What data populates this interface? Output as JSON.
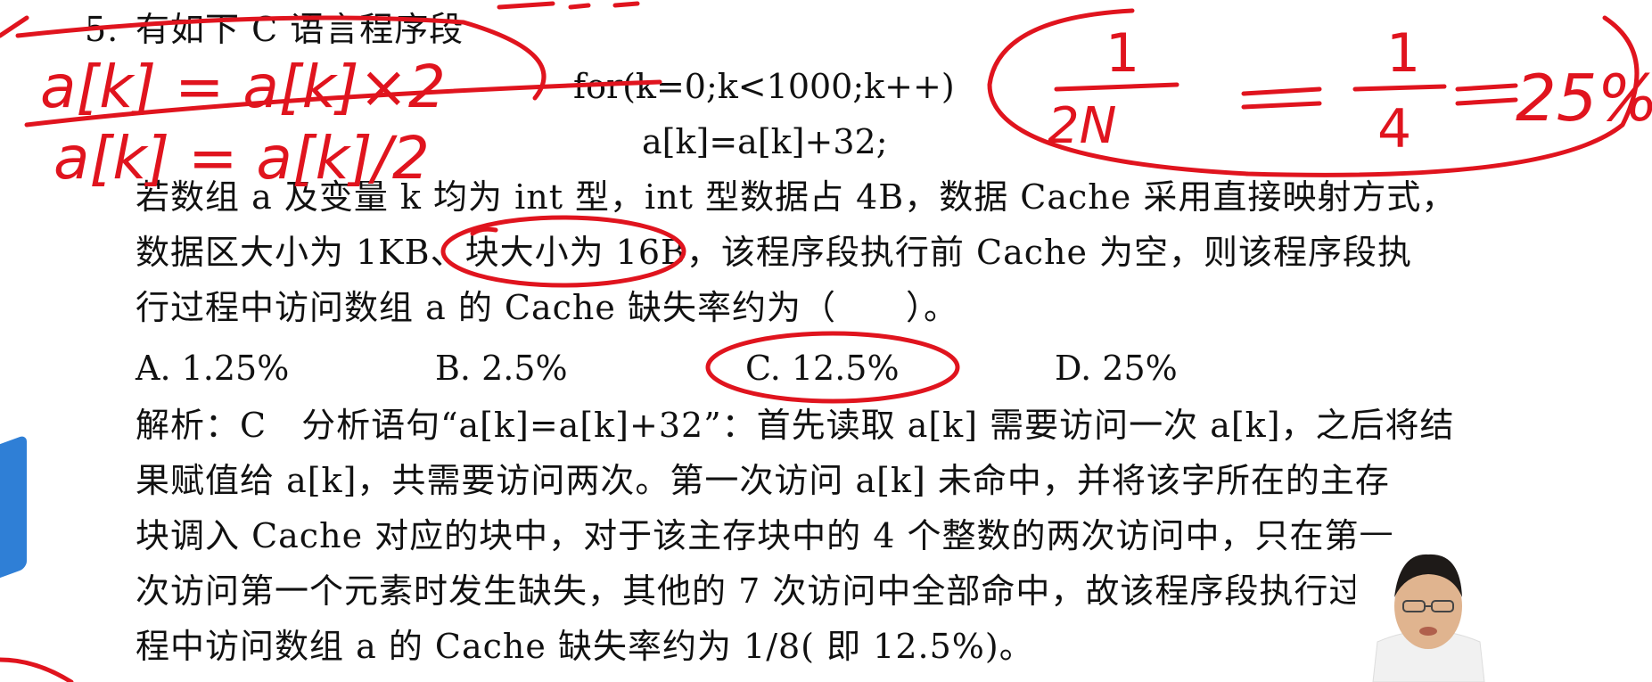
{
  "question": {
    "number": "5.",
    "title": "有如下 C 语言程序段",
    "code_line1": "for(k=0;k<1000;k++)",
    "code_line2": "a[k]=a[k]+32;",
    "body_lines": [
      "若数组 a 及变量 k 均为 int 型，int 型数据占 4B，数据 Cache 采用直接映射方式，",
      "数据区大小为 1KB、块大小为 16B，该程序段执行前 Cache 为空，则该程序段执",
      "行过程中访问数组 a 的 Cache 缺失率约为（　　）。"
    ],
    "options": {
      "a": "A.  1.25%",
      "b": "B.  2.5%",
      "c": "C.  12.5%",
      "d": "D.  25%"
    }
  },
  "analysis": {
    "lines": [
      "解析：C　分析语句“a[k]=a[k]+32”：首先读取 a[k] 需要访问一次 a[k]，之后将结",
      "果赋值给 a[k]，共需要访问两次。第一次访问 a[k] 未命中，并将该字所在的主存",
      "块调入 Cache 对应的块中，对于该主存块中的 4 个整数的两次访问中，只在第一",
      "次访问第一个元素时发生缺失，其他的 7 次访问中全部命中，故该程序段执行过",
      "程中访问数组 a 的 Cache 缺失率约为 1/8( 即 12.5%)。"
    ]
  },
  "annotations": {
    "line1": "a[k] = a[k]×2",
    "line2": "a[k] = a[k]/2",
    "frac1_num": "1",
    "frac1_den": "2N",
    "eq": "=",
    "frac2_num": "1",
    "frac2_den": "4",
    "eq2": "=",
    "result": "25%",
    "ink_color": "#e0141e"
  }
}
